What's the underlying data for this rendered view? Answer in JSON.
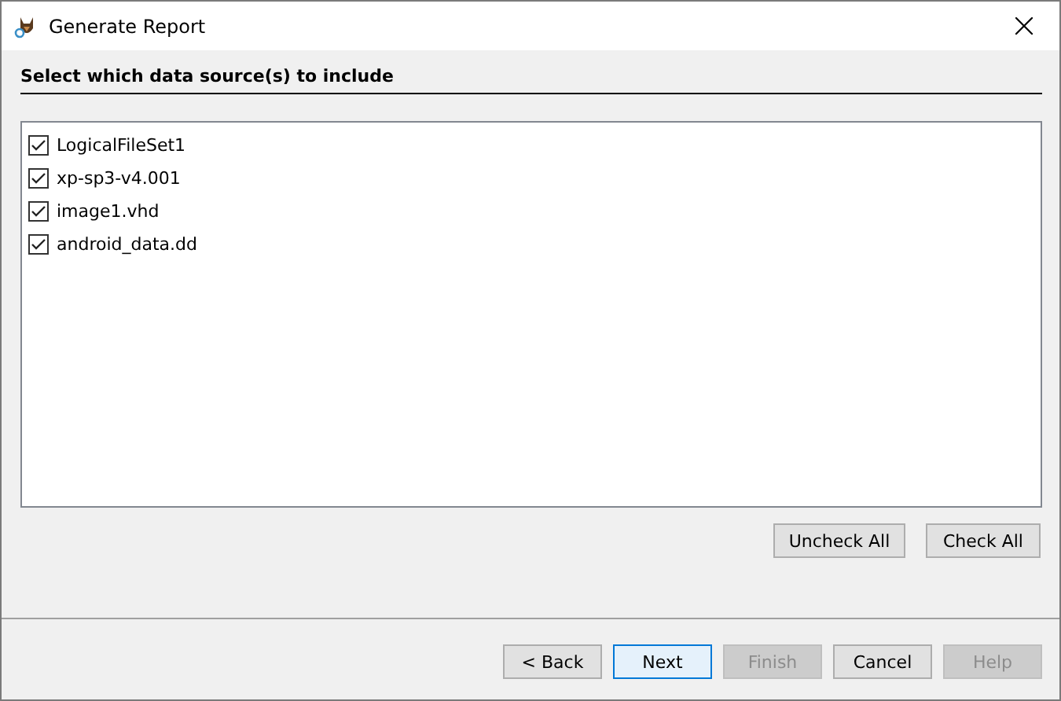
{
  "window": {
    "title": "Generate Report"
  },
  "heading": "Select which data source(s) to include",
  "data_sources": [
    {
      "label": "LogicalFileSet1",
      "checked": true
    },
    {
      "label": "xp-sp3-v4.001",
      "checked": true
    },
    {
      "label": "image1.vhd",
      "checked": true
    },
    {
      "label": "android_data.dd",
      "checked": true
    }
  ],
  "list_buttons": [
    "Uncheck All",
    "Check All"
  ],
  "buttons": [
    {
      "label": "< Back",
      "default": false,
      "disabled": false
    },
    {
      "label": "Next",
      "default": true,
      "disabled": false
    },
    {
      "label": "Finish",
      "default": false,
      "disabled": true
    },
    {
      "label": "Cancel",
      "default": false,
      "disabled": false
    },
    {
      "label": "Help",
      "default": false,
      "disabled": true
    }
  ]
}
